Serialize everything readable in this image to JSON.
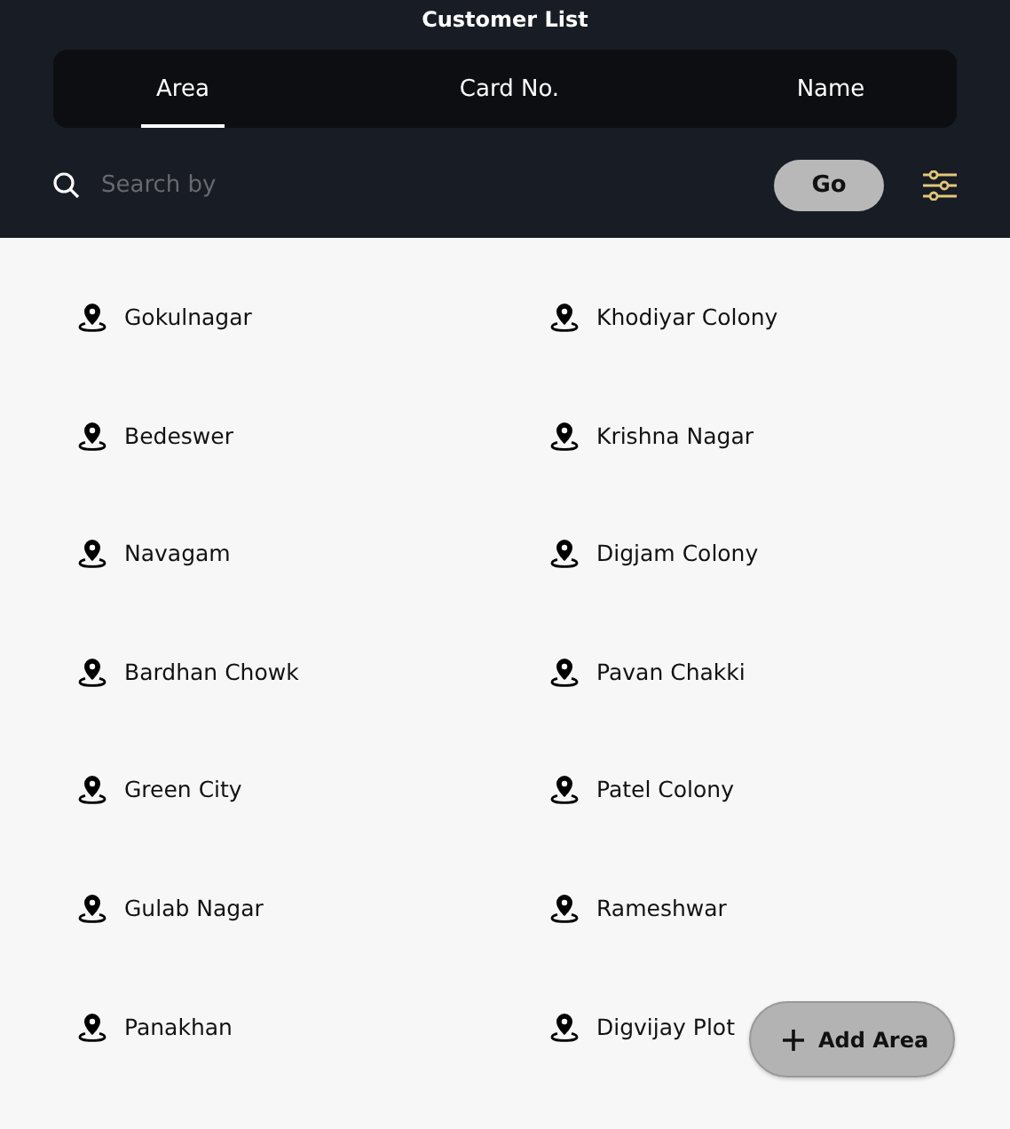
{
  "header": {
    "title": "Customer List"
  },
  "tabs": [
    {
      "label": "Area",
      "selected": true
    },
    {
      "label": "Card No.",
      "selected": false
    },
    {
      "label": "Name",
      "selected": false
    }
  ],
  "search": {
    "placeholder": "Search by",
    "button": "Go"
  },
  "areas": [
    "Gokulnagar",
    "Khodiyar Colony",
    "Bedeswer",
    "Krishna Nagar",
    "Navagam",
    "Digjam Colony",
    "Bardhan Chowk",
    "Pavan Chakki",
    "Green City",
    "Patel Colony",
    "Gulab Nagar",
    "Rameshwar",
    "Panakhan",
    "Digvijay Plot"
  ],
  "add_button": {
    "label": "Add Area"
  }
}
